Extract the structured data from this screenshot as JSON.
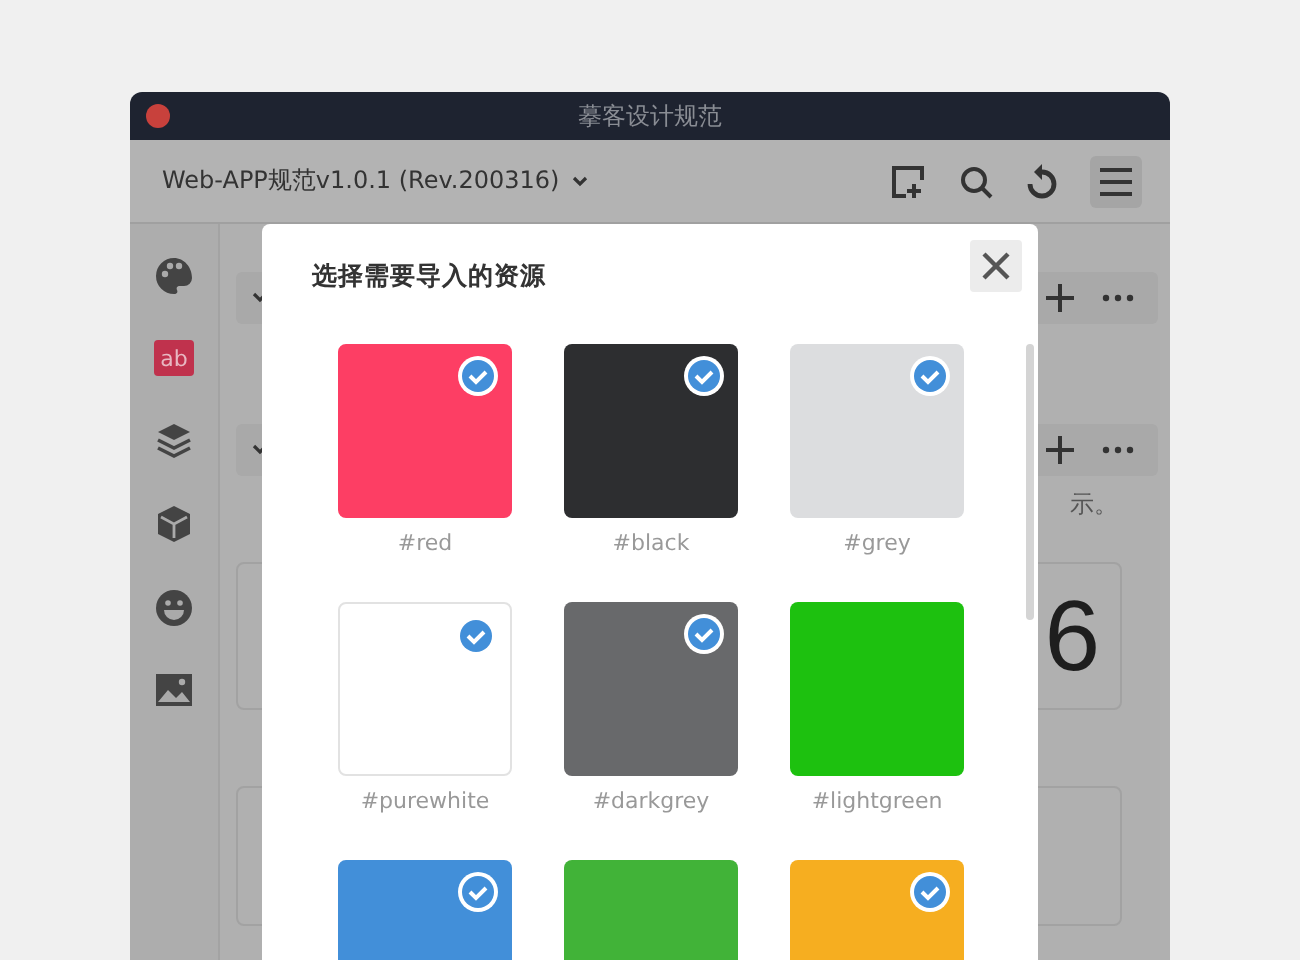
{
  "window": {
    "title": "摹客设计规范"
  },
  "toolbar": {
    "project": "Web-APP规范v1.0.1 (Rev.200316)"
  },
  "sidebar": {
    "text_badge": "ab"
  },
  "background": {
    "note": "示。",
    "number": "6"
  },
  "dialog": {
    "title": "选择需要导入的资源",
    "swatches": [
      {
        "label": "#red",
        "color": "#fd3e64",
        "selected": true
      },
      {
        "label": "#black",
        "color": "#2d2e30",
        "selected": true
      },
      {
        "label": "#grey",
        "color": "#dcdddf",
        "selected": true
      },
      {
        "label": "#purewhite",
        "color": "#ffffff",
        "selected": true
      },
      {
        "label": "#darkgrey",
        "color": "#68696b",
        "selected": true
      },
      {
        "label": "#lightgreen",
        "color": "#1dc10f",
        "selected": false
      },
      {
        "color": "#428fd9",
        "selected": true
      },
      {
        "color": "#41b338",
        "selected": false
      },
      {
        "color": "#f6ae20",
        "selected": true
      }
    ]
  }
}
